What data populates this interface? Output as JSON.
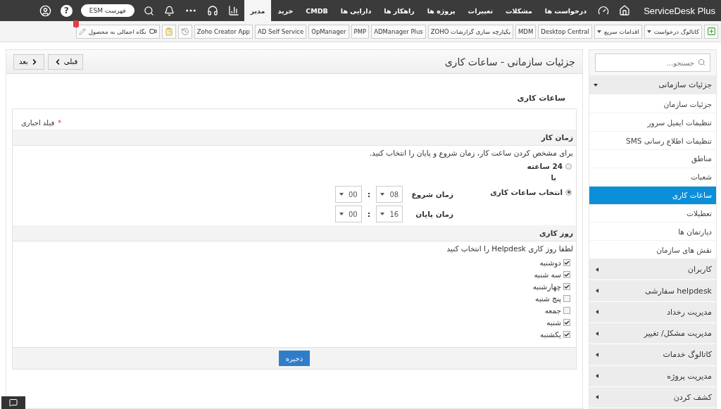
{
  "top_nav": {
    "logo": "ServiceDesk Plus",
    "items": [
      {
        "label": "درخواست ها",
        "selected": false
      },
      {
        "label": "مشکلات",
        "selected": false
      },
      {
        "label": "تغییرات",
        "selected": false
      },
      {
        "label": "پروژه ها",
        "selected": false
      },
      {
        "label": "راهکار ها",
        "selected": false
      },
      {
        "label": "دارایی ها",
        "selected": false
      },
      {
        "label": "CMDB",
        "selected": false
      },
      {
        "label": "خرید",
        "selected": false
      },
      {
        "label": "مدیر",
        "selected": true
      }
    ],
    "esm_button": "فهرست ESM",
    "help": "?"
  },
  "toolbar": {
    "dropdowns": [
      "کاتالوگ درخواست",
      "اقدامات سریع"
    ],
    "links": [
      "Desktop Central",
      "MDM",
      "یکپارچه سازی گزارشات ZOHO",
      "ADManager Plus",
      "PMP",
      "OpManager",
      "AD Self Service",
      "Zoho Creator App"
    ],
    "tour_button": "نگاه اجمالی به محصول"
  },
  "sidebar": {
    "search": {
      "placeholder": "جستجو..."
    },
    "groups": [
      {
        "label": "جزئیات سازمانی",
        "expanded": true,
        "children": [
          {
            "label": "جزئیات سازمان",
            "selected": false
          },
          {
            "label": "تنظیمات ایمیل سرور",
            "selected": false
          },
          {
            "label": "تنظیمات اطلاع رسانی SMS",
            "selected": false
          },
          {
            "label": "مناطق",
            "selected": false
          },
          {
            "label": "شعبات",
            "selected": false
          },
          {
            "label": "ساعات کاری",
            "selected": true
          },
          {
            "label": "تعطیلات",
            "selected": false
          },
          {
            "label": "دپارتمان ها",
            "selected": false
          },
          {
            "label": "نقش های سازمان",
            "selected": false
          }
        ]
      },
      {
        "label": "کاربران",
        "expanded": false
      },
      {
        "label": "helpdesk سفارشی",
        "expanded": false
      },
      {
        "label": "مدیریت رخداد",
        "expanded": false
      },
      {
        "label": "مدیریت مشکل/ تغییر",
        "expanded": false
      },
      {
        "label": "کاتالوگ خدمات",
        "expanded": false
      },
      {
        "label": "مدیریت پروژه",
        "expanded": false
      },
      {
        "label": "کشف کردن",
        "expanded": false
      }
    ]
  },
  "page": {
    "title": "جزئیات سازمانی - ساعات کاری",
    "buttons": [
      {
        "label": "قبلی",
        "kind": "prev"
      },
      {
        "label": "بعد",
        "kind": "next"
      }
    ],
    "section_title": "ساعات کاری",
    "required_marker": "*",
    "required_note": "فیلد اجباری",
    "work_time": {
      "heading": "زمان کار",
      "hint": "برای مشخص کردن ساعت کار، زمان شروع و پایان را انتخاب کنید.",
      "options": [
        {
          "label": "24 ساعته",
          "selected": false
        },
        {
          "label": "انتخاب ساعات کاری",
          "selected": true
        }
      ],
      "or": "یا",
      "times": [
        {
          "label": "زمان شروع",
          "hour": "08",
          "separator": ":",
          "minute": "00"
        },
        {
          "label": "زمان پایان",
          "hour": "16",
          "separator": ":",
          "minute": "00"
        }
      ]
    },
    "work_days": {
      "heading": "روز کاری",
      "hint": "لطفا روز کاری Helpdesk را انتخاب کنید",
      "days": [
        {
          "label": "دوشنبه",
          "checked": true
        },
        {
          "label": "سه شنبه",
          "checked": true
        },
        {
          "label": "چهارشنبه",
          "checked": true
        },
        {
          "label": "پنج شنبه",
          "checked": false
        },
        {
          "label": "جمعه",
          "checked": false
        },
        {
          "label": "شنبه",
          "checked": true
        },
        {
          "label": "یکشنبه",
          "checked": true
        }
      ]
    },
    "save_button": "ذخیره"
  }
}
